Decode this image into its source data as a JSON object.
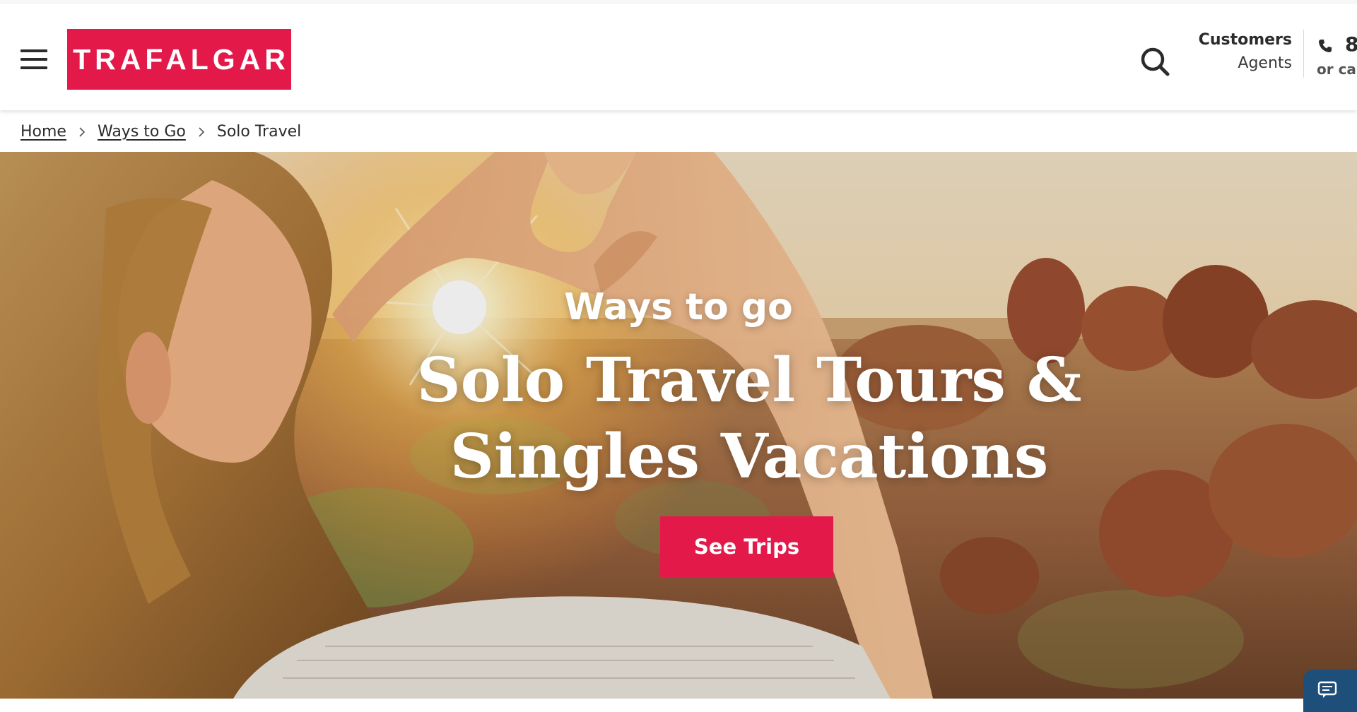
{
  "header": {
    "brand": "TRAFALGAR",
    "audience": {
      "customers": "Customers",
      "agents": "Agents"
    },
    "phone": {
      "number": "8",
      "sub": "or call"
    }
  },
  "breadcrumb": {
    "items": [
      "Home",
      "Ways to Go"
    ],
    "current": "Solo Travel"
  },
  "hero": {
    "kicker": "Ways to go",
    "title": "Solo Travel Tours & Singles Vacations",
    "cta": "See Trips"
  },
  "icons": {
    "menu": "hamburger-menu-icon",
    "search": "search-icon",
    "phone": "phone-icon",
    "breadcrumb_separator": "chevron-right-icon",
    "chat": "chat-icon"
  },
  "colors": {
    "brand": "#e3194a",
    "text": "#2b2b2b",
    "chat": "#1d4f7a"
  }
}
